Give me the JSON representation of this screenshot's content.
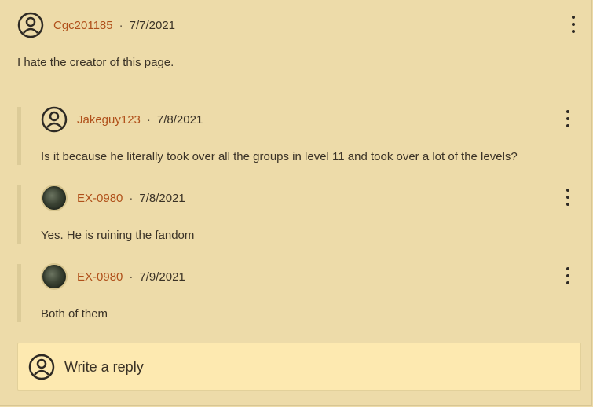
{
  "comments": [
    {
      "user": "Cgc201185",
      "date": "7/7/2021",
      "text": "I hate the creator of this page.",
      "avatar": "user-outline-icon"
    },
    {
      "user": "Jakeguy123",
      "date": "7/8/2021",
      "text": "Is it because he literally took over all the groups in level 11 and took over a lot of the levels?",
      "avatar": "user-outline-icon"
    },
    {
      "user": "EX-0980",
      "date": "7/8/2021",
      "text": "Yes. He is ruining the fandom",
      "avatar": "profile-photo"
    },
    {
      "user": "EX-0980",
      "date": "7/9/2021",
      "text": "Both of them",
      "avatar": "profile-photo"
    }
  ],
  "separator": "·",
  "reply": {
    "placeholder": "Write a reply",
    "avatar": "user-outline-icon"
  },
  "colors": {
    "background": "#eddba9",
    "username": "#b0501a",
    "reply_box": "#fde9b0"
  }
}
